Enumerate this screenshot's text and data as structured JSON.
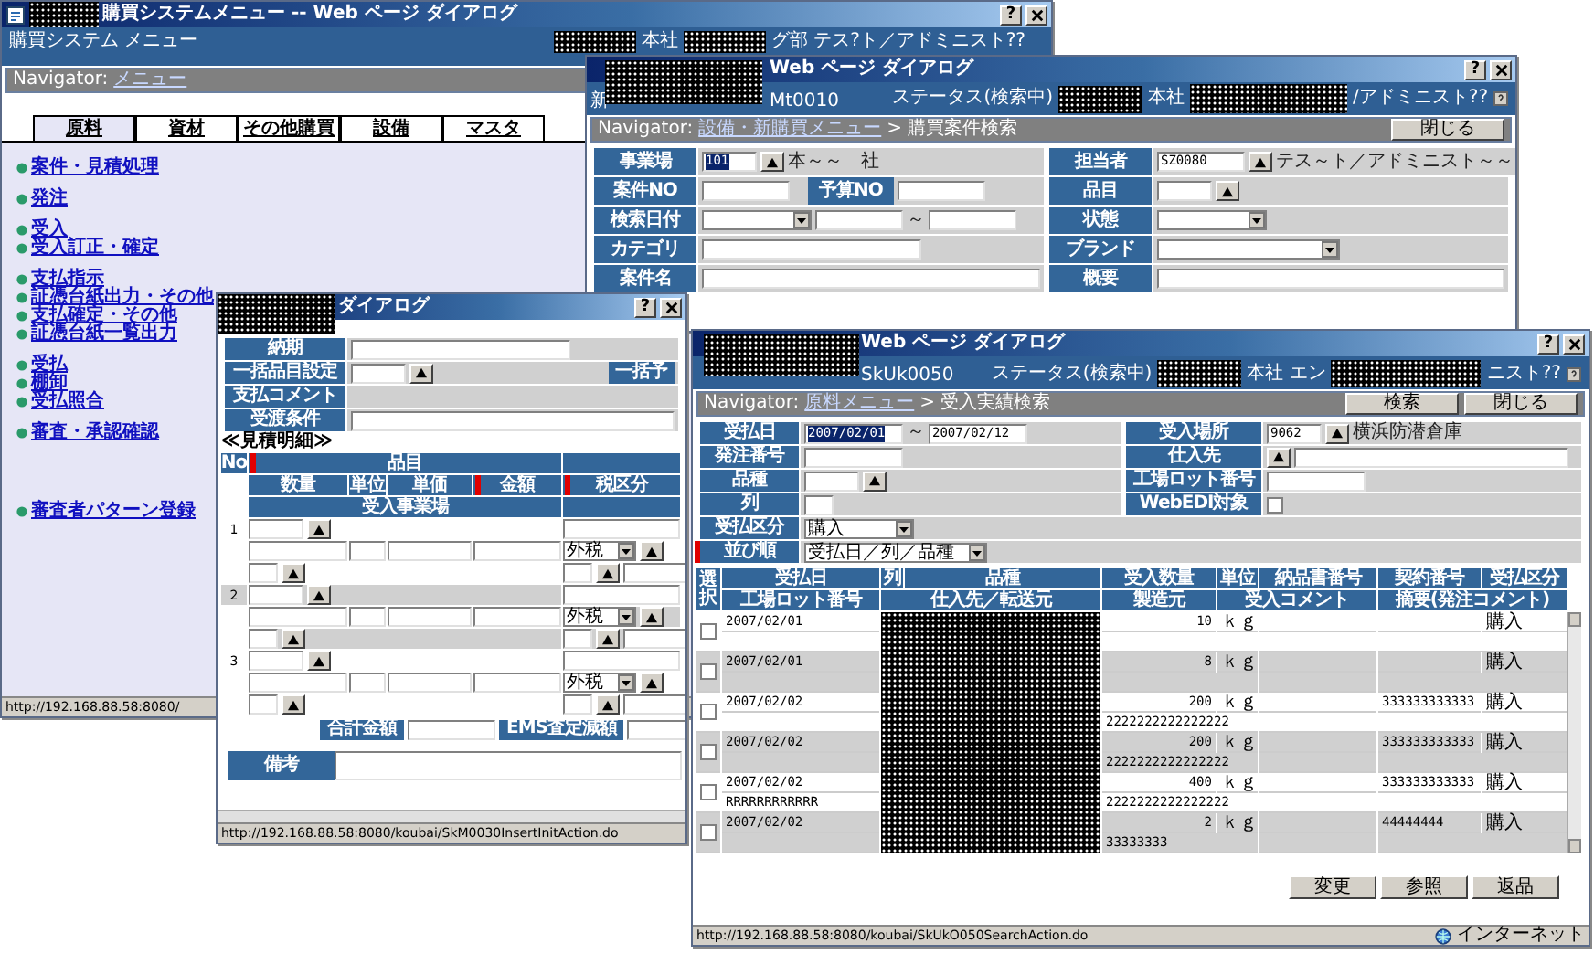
{
  "menu_window": {
    "title": "購買システムメニュー -- Web ページ ダイアログ",
    "help": "?",
    "header_title": "購買システム メニュー",
    "user_office": "本社",
    "user_name": "グ部 テス?ト／アドミニスト??",
    "navigator_label": "Navigator:",
    "navigator_link": "メニュー",
    "tabs": [
      {
        "label": "原料",
        "selected": true
      },
      {
        "label": "資材",
        "selected": false
      },
      {
        "label": "その他購買",
        "selected": false
      },
      {
        "label": "設備",
        "selected": false
      },
      {
        "label": "マスタ",
        "selected": false
      }
    ],
    "menu_groups": [
      [
        "案件・見積処理"
      ],
      [
        "発注"
      ],
      [
        "受入",
        "受入訂正・確定"
      ],
      [
        "支払指示",
        "証憑台紙出力・その他",
        "支払確定・その他",
        "証憑台紙一覧出力"
      ],
      [
        "受払",
        "棚卸",
        "受払照合"
      ],
      [
        "審査・承認確認"
      ],
      [
        "審査者パターン登録"
      ]
    ],
    "status_url": "http://192.168.88.58:8080/"
  },
  "search_window": {
    "title": "Web ページ ダイアログ",
    "help": "?",
    "header_left": "新",
    "header_code": "Mt0010",
    "status_label": "ステータス(検索中)",
    "user_office": "本社",
    "user_name": "/アドミニスト??",
    "navigator_label": "Navigator:",
    "navigator_link": "設備・新購買メニュー",
    "navigator_separator": ">",
    "navigator_current": "購買案件検索",
    "buttons": [
      "閉じる"
    ],
    "rows": [
      {
        "cells": [
          {
            "label": "事業場",
            "items": [
              {
                "kind": "shortfield",
                "value": "101",
                "highlighted": true
              },
              {
                "kind": "lookup"
              },
              {
                "kind": "text",
                "text": "本～～　社"
              }
            ]
          },
          {
            "label": "担当者",
            "items": [
              {
                "kind": "field",
                "value": "SZ0080",
                "highlighted": false
              },
              {
                "kind": "lookup"
              },
              {
                "kind": "text",
                "text": "テス～ト／アドミニスト～～"
              }
            ]
          }
        ]
      },
      {
        "cells": [
          {
            "label": "案件NO",
            "items": [
              {
                "kind": "field"
              },
              {
                "kind": "label",
                "text": "予算NO"
              },
              {
                "kind": "field"
              }
            ]
          },
          {
            "label": "品目",
            "items": [
              {
                "kind": "shortfield"
              },
              {
                "kind": "lookup"
              }
            ]
          }
        ]
      },
      {
        "cells": [
          {
            "label": "検索日付",
            "items": [
              {
                "kind": "select"
              },
              {
                "kind": "field"
              },
              {
                "kind": "text",
                "text": "～"
              },
              {
                "kind": "field"
              }
            ]
          },
          {
            "label": "状態",
            "items": [
              {
                "kind": "select"
              }
            ]
          }
        ]
      },
      {
        "cells": [
          {
            "label": "カテゴリ",
            "items": [
              {
                "kind": "widefield"
              }
            ]
          },
          {
            "label": "ブランド",
            "items": [
              {
                "kind": "wideselect"
              }
            ]
          }
        ]
      },
      {
        "cells": [
          {
            "label": "案件名",
            "items": [
              {
                "kind": "fullfield"
              }
            ]
          },
          {
            "label": "概要",
            "items": [
              {
                "kind": "fullfield"
              }
            ]
          }
        ]
      }
    ]
  },
  "estimate_window": {
    "title": "ダイアログ",
    "help": "?",
    "rows": [
      {
        "label": "納期",
        "items": [
          {
            "kind": "widefield"
          }
        ]
      },
      {
        "label": "一括品目設定",
        "items": [
          {
            "kind": "shortfield"
          },
          {
            "kind": "lookup"
          },
          {
            "kind": "label",
            "text": "一括予"
          }
        ]
      },
      {
        "label": "支払コメント"
      },
      {
        "label": "受渡条件",
        "items": [
          {
            "kind": "fullfield"
          }
        ]
      }
    ],
    "section_title": "≪見積明細≫",
    "table": {
      "group_header": "品目",
      "group_required": true,
      "no_header": "No",
      "columns": [
        {
          "label": "数量",
          "required": false
        },
        {
          "label": "単位",
          "required": false
        },
        {
          "label": "単価",
          "required": false
        },
        {
          "label": "金額",
          "required": true
        },
        {
          "label": "税区分",
          "required": true
        }
      ],
      "sub_header": "受入事業場",
      "rows": [
        {
          "no": "1",
          "tax": "外税"
        },
        {
          "no": "2",
          "tax": "外税"
        },
        {
          "no": "3",
          "tax": "外税"
        }
      ]
    },
    "totals": [
      "合計金額",
      "EMS査定減額"
    ],
    "remarks_label": "備考",
    "status_url": "http://192.168.88.58:8080/koubai/SkM0030InsertInitAction.do"
  },
  "receipt_window": {
    "title": "Web ページ ダイアログ",
    "help": "?",
    "header_code": "SkUk0050",
    "status_label": "ステータス(検索中)",
    "user_office": "本社 エン",
    "user_name": "ニスト??",
    "navigator_label": "Navigator:",
    "navigator_link": "原料メニュー",
    "navigator_separator": ">",
    "navigator_current": "受入実績検索",
    "buttons": [
      "検索",
      "閉じる"
    ],
    "rows": [
      {
        "cells": [
          {
            "label": "受払日",
            "items": [
              {
                "kind": "field",
                "value": "2007/02/01",
                "highlighted": true
              },
              {
                "kind": "text",
                "text": "～"
              },
              {
                "kind": "field",
                "value": "2007/02/12",
                "highlighted": false
              }
            ]
          },
          {
            "label": "受入場所",
            "items": [
              {
                "kind": "shortfield",
                "value": "9062",
                "highlighted": false
              },
              {
                "kind": "lookup"
              },
              {
                "kind": "text",
                "text": "横浜防潜倉庫"
              }
            ]
          }
        ]
      },
      {
        "cells": [
          {
            "label": "発注番号",
            "items": [
              {
                "kind": "field"
              }
            ]
          },
          {
            "label": "仕入先",
            "items": [
              {
                "kind": "lookup"
              },
              {
                "kind": "longfield"
              }
            ]
          }
        ]
      },
      {
        "cells": [
          {
            "label": "品種",
            "items": [
              {
                "kind": "shortfield"
              },
              {
                "kind": "lookup"
              }
            ]
          },
          {
            "label": "工場ロット番号",
            "items": [
              {
                "kind": "field"
              }
            ]
          }
        ]
      },
      {
        "cells": [
          {
            "label": "列",
            "items": [
              {
                "kind": "tinyfield"
              }
            ]
          },
          {
            "label": "WebEDI対象",
            "items": [
              {
                "kind": "checkbox",
                "checked": false
              }
            ]
          }
        ]
      },
      {
        "cells": [
          {
            "label": "受払区分",
            "items": [
              {
                "kind": "select",
                "value": "購入"
              }
            ]
          }
        ]
      },
      {
        "cells": [
          {
            "label": "並び順",
            "required": true,
            "items": [
              {
                "kind": "wideselect",
                "value": "受払日／列／品種"
              }
            ]
          }
        ]
      }
    ],
    "table": {
      "select_header": "選択",
      "columns": [
        "受払日",
        "列",
        "品種",
        "受入数量",
        "単位",
        "納品書番号",
        "契約番号",
        "受払区分"
      ],
      "columns_row2": [
        "工場ロット番号",
        "仕入先／転送元",
        "製造元",
        "受入コメント",
        "摘要(発注コメント)"
      ],
      "rows": [
        {
          "checked": false,
          "date": "2007/02/01",
          "quantity": "10",
          "unit": "ｋｇ",
          "category": "購入"
        },
        {
          "checked": false,
          "date": "2007/02/01",
          "quantity": "8",
          "unit": "ｋｇ",
          "category": "購入"
        },
        {
          "checked": false,
          "date": "2007/02/02",
          "quantity": "200",
          "unit": "ｋｇ",
          "contract_no": "333333333333",
          "category": "購入",
          "maker": "2222222222222222"
        },
        {
          "checked": false,
          "date": "2007/02/02",
          "quantity": "200",
          "unit": "ｋｇ",
          "contract_no": "333333333333",
          "category": "購入",
          "maker": "2222222222222222"
        },
        {
          "checked": false,
          "date": "2007/02/02",
          "quantity": "400",
          "unit": "ｋｇ",
          "contract_no": "333333333333",
          "category": "購入",
          "lot_no": "RRRRRRRRRRRR",
          "maker": "2222222222222222"
        },
        {
          "checked": false,
          "date": "2007/02/02",
          "quantity": "2",
          "unit": "ｋｇ",
          "contract_no": "44444444",
          "category": "購入",
          "maker": "33333333"
        }
      ]
    },
    "actions": [
      "変更",
      "参照",
      "返品"
    ],
    "status_url": "http://192.168.88.58:8080/koubai/SkUkO050SearchAction.do",
    "zone": "インターネット"
  }
}
